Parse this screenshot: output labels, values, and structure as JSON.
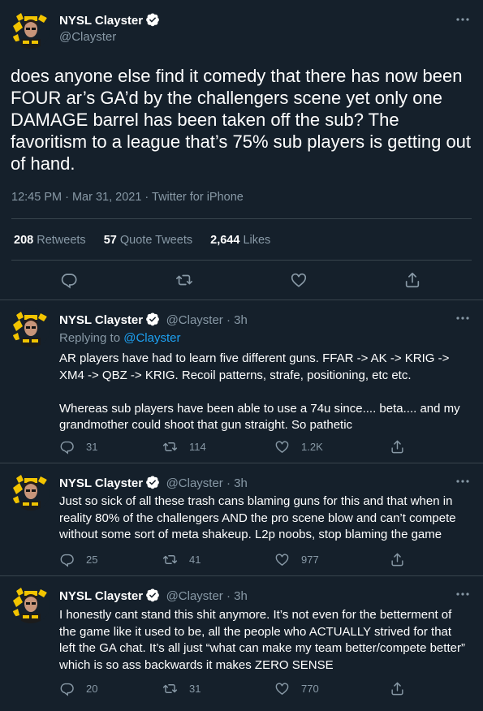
{
  "main_tweet": {
    "display_name": "NYSL Clayster",
    "handle": "@Clayster",
    "text": "does anyone else find it comedy that there has now been FOUR ar’s GA’d by the challengers scene yet only one DAMAGE barrel has been taken off the sub? The favoritism to a league that’s 75% sub players is getting out of hand.",
    "timestamp": "12:45 PM · Mar 31, 2021 · ",
    "source": "Twitter for iPhone",
    "stats": {
      "retweets_count": "208",
      "retweets_label": "Retweets",
      "quotes_count": "57",
      "quotes_label": "Quote Tweets",
      "likes_count": "2,644",
      "likes_label": "Likes"
    }
  },
  "replies": [
    {
      "display_name": "NYSL Clayster",
      "handle_time": "@Clayster · 3h",
      "replying_label": "Replying to ",
      "replying_to": "@Clayster",
      "text": "AR players have had to learn five different guns. FFAR -> AK -> KRIG -> XM4 -> QBZ -> KRIG. Recoil patterns, strafe, positioning, etc etc.\n\nWhereas sub players have been able to use a 74u since.... beta.... and my grandmother could shoot that gun straight. So pathetic",
      "reply_count": "31",
      "retweet_count": "114",
      "like_count": "1.2K"
    },
    {
      "display_name": "NYSL Clayster",
      "handle_time": "@Clayster · 3h",
      "text": "Just so sick of all these trash cans blaming guns for this and that when in reality 80% of the challengers AND the pro scene blow and can’t compete without some sort of meta shakeup. L2p noobs, stop blaming the game",
      "reply_count": "25",
      "retweet_count": "41",
      "like_count": "977"
    },
    {
      "display_name": "NYSL Clayster",
      "handle_time": "@Clayster · 3h",
      "text": "I honestly cant stand this shit anymore. It’s not even for the betterment of the game like it used to be, all the people who ACTUALLY strived for that left the GA chat. It’s all just “what can make my team better/compete better” which is so ass backwards it makes ZERO SENSE",
      "reply_count": "20",
      "retweet_count": "31",
      "like_count": "770"
    }
  ],
  "colors": {
    "background": "#15202b",
    "text": "#d9d9d9",
    "muted": "#8899a6",
    "link": "#1da1f2",
    "separator": "#38444d"
  },
  "icons": [
    "verified-badge-icon",
    "more-options-icon",
    "reply-icon",
    "retweet-icon",
    "like-icon",
    "share-icon",
    "avatar-image"
  ]
}
